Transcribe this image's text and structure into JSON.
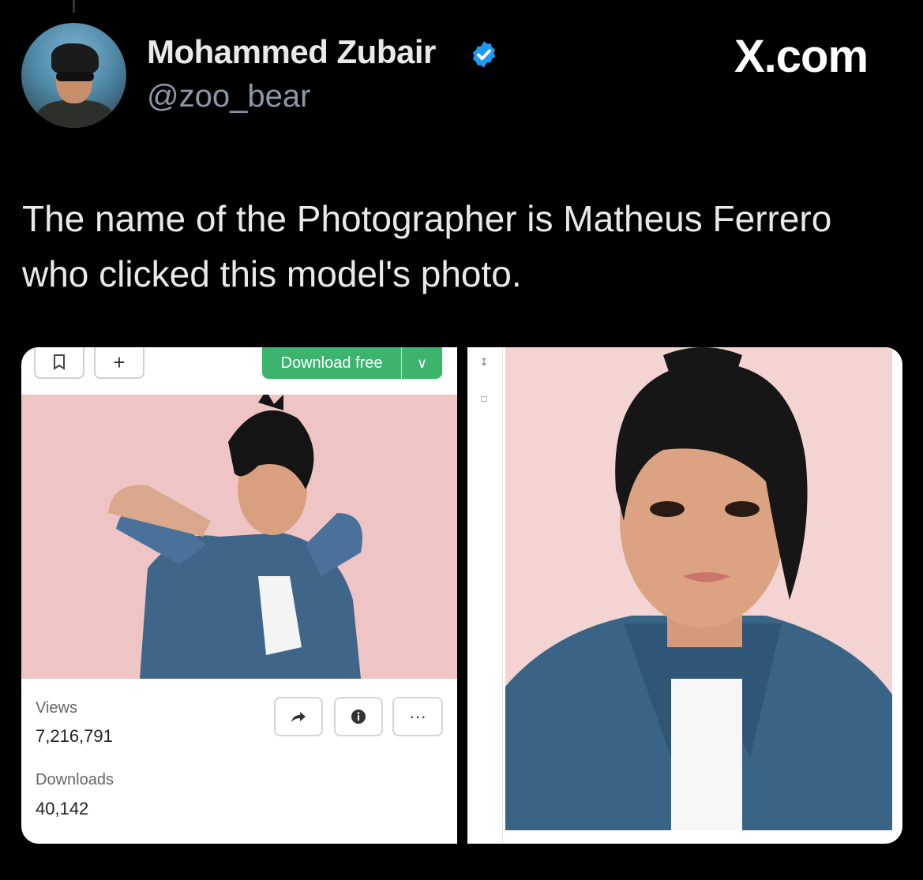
{
  "header": {
    "display_name": "Mohammed Zubair",
    "handle": "@zoo_bear",
    "site_logo": "X.com",
    "verified_color": "#1d9bf0"
  },
  "tweet": {
    "text": "The name of the Photographer is Matheus Ferrero who clicked this model's photo."
  },
  "screenshot_left": {
    "download_label": "Download free",
    "views_label": "Views",
    "views_value": "7,216,791",
    "downloads_label": "Downloads",
    "downloads_value": "40,142"
  },
  "colors": {
    "background": "#000000",
    "download_button": "#3cb46e",
    "photo_bg": "#f0c6c6"
  }
}
